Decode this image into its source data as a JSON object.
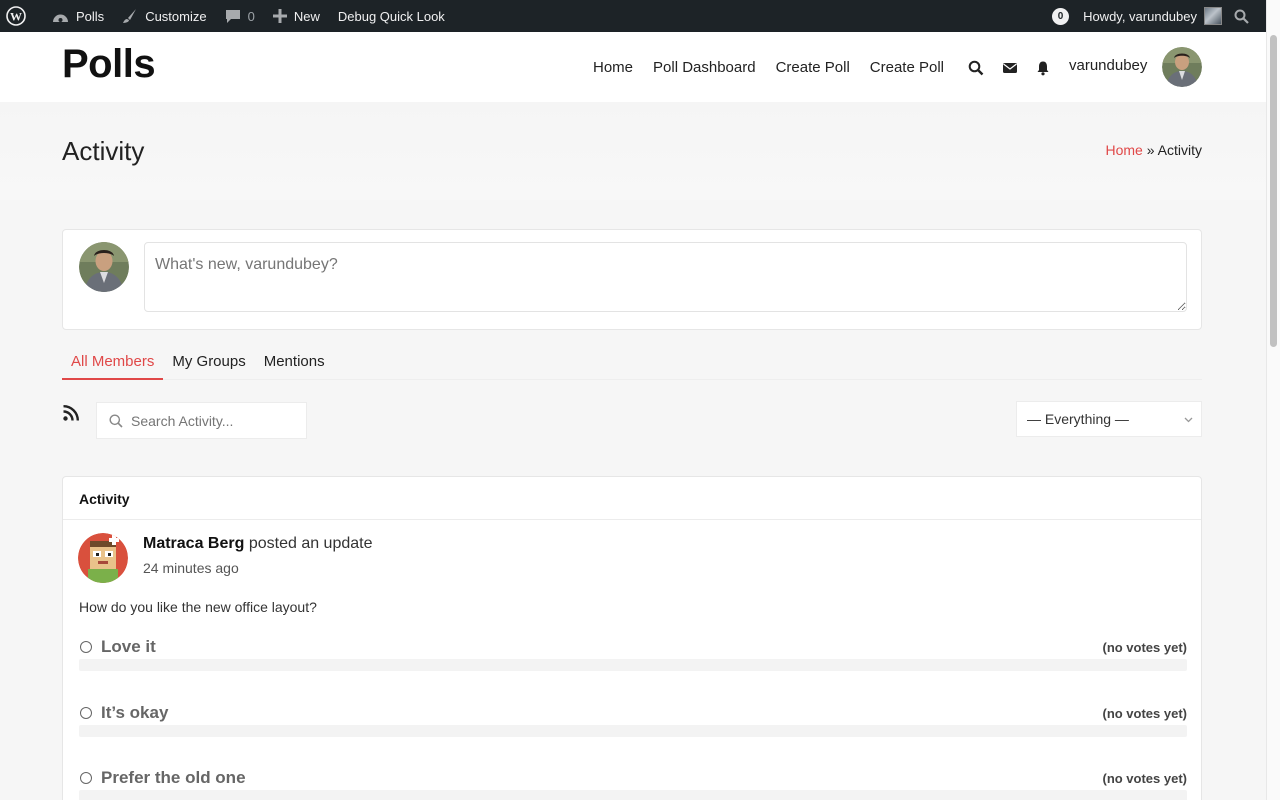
{
  "adminbar": {
    "site_name": "Polls",
    "customize": "Customize",
    "comments_count": "0",
    "new_label": "New",
    "debug": "Debug Quick Look",
    "notif_count": "0",
    "howdy": "Howdy, varundubey"
  },
  "header": {
    "logo": "Polls",
    "nav": [
      "Home",
      "Poll Dashboard",
      "Create Poll",
      "Create Poll"
    ],
    "username": "varundubey"
  },
  "page": {
    "title": "Activity",
    "breadcrumb_home": "Home",
    "breadcrumb_sep": "»",
    "breadcrumb_current": "Activity"
  },
  "post_box": {
    "placeholder": "What's new, varundubey?"
  },
  "tabs": [
    "All Members",
    "My Groups",
    "Mentions"
  ],
  "filters": {
    "search_placeholder": "Search Activity...",
    "select_value": "— Everything —"
  },
  "activity": {
    "heading": "Activity",
    "author": "Matraca Berg",
    "action": "posted an update",
    "time": "24 minutes ago",
    "question": "How do you like the new office layout?",
    "options": [
      {
        "label": "Love it",
        "votes": "(no votes yet)",
        "fraction": 0
      },
      {
        "label": "It’s okay",
        "votes": "(no votes yet)",
        "fraction": 0
      },
      {
        "label": "Prefer the old one",
        "votes": "(no votes yet)",
        "fraction": 0
      }
    ]
  },
  "colors": {
    "accent": "#e04848",
    "adminbar": "#1d2327"
  }
}
